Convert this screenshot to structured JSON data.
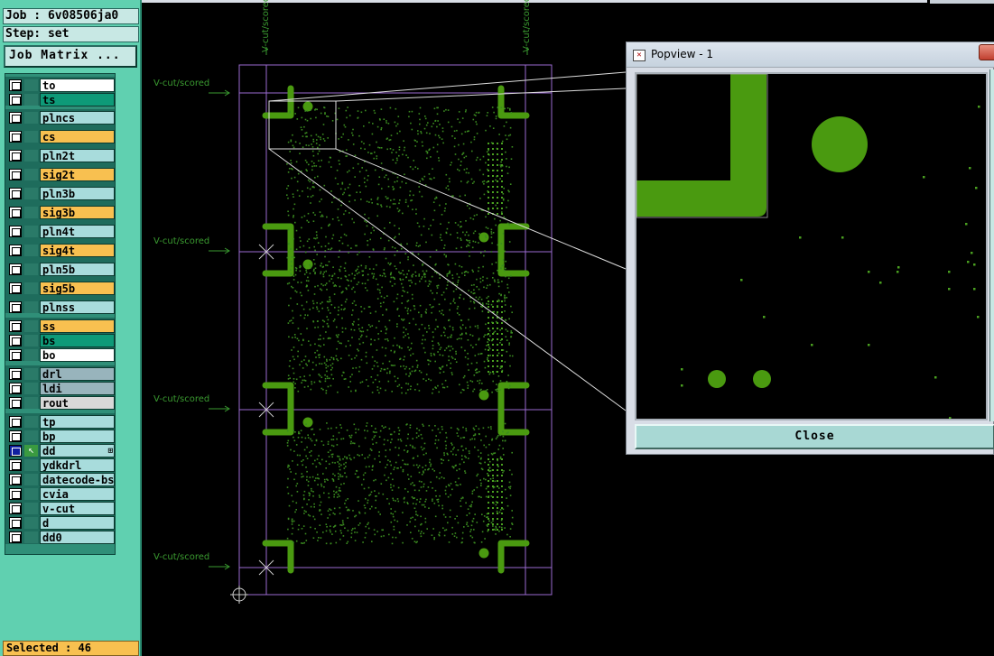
{
  "header": {
    "job": "Job : 6v08506ja0",
    "step": "Step: set",
    "job_matrix_label": "Job Matrix ..."
  },
  "layers": [
    {
      "name": "to",
      "color": "#ffffff",
      "group": 0
    },
    {
      "name": "ts",
      "color": "#0e9a78",
      "group": 0
    },
    {
      "name": "plncs",
      "color": "#a8dcdc",
      "group": 1
    },
    {
      "name": "cs",
      "color": "#f8c050",
      "group": 1
    },
    {
      "name": "pln2t",
      "color": "#a8dcdc",
      "group": 1
    },
    {
      "name": "sig2t",
      "color": "#f8c050",
      "group": 1
    },
    {
      "name": "pln3b",
      "color": "#a8dcdc",
      "group": 1
    },
    {
      "name": "sig3b",
      "color": "#f8c050",
      "group": 1
    },
    {
      "name": "pln4t",
      "color": "#a8dcdc",
      "group": 1
    },
    {
      "name": "sig4t",
      "color": "#f8c050",
      "group": 1
    },
    {
      "name": "pln5b",
      "color": "#a8dcdc",
      "group": 1
    },
    {
      "name": "sig5b",
      "color": "#f8c050",
      "group": 1
    },
    {
      "name": "plnss",
      "color": "#a8dcdc",
      "group": 1
    },
    {
      "name": "ss",
      "color": "#f8c050",
      "group": 2
    },
    {
      "name": "bs",
      "color": "#0e9a78",
      "group": 2
    },
    {
      "name": "bo",
      "color": "#ffffff",
      "group": 2
    },
    {
      "name": "drl",
      "color": "#98b4bc",
      "group": 3
    },
    {
      "name": "ldi",
      "color": "#98b4bc",
      "group": 3
    },
    {
      "name": "rout",
      "color": "#d8d8d8",
      "group": 3
    },
    {
      "name": "tp",
      "color": "#a8dcdc",
      "group": 4
    },
    {
      "name": "bp",
      "color": "#a8dcdc",
      "group": 4
    },
    {
      "name": "dd",
      "color": "#a8dcdc",
      "group": 4,
      "selected": true,
      "icon": "arrow-icon"
    },
    {
      "name": "ydkdrl",
      "color": "#a8dcdc",
      "group": 4
    },
    {
      "name": "datecode-bs",
      "color": "#a8dcdc",
      "group": 4
    },
    {
      "name": "cvia",
      "color": "#a8dcdc",
      "group": 4
    },
    {
      "name": "v-cut",
      "color": "#a8dcdc",
      "group": 4
    },
    {
      "name": "d",
      "color": "#a8dcdc",
      "group": 4
    },
    {
      "name": "dd0",
      "color": "#a8dcdc",
      "group": 4
    }
  ],
  "status": {
    "selected": "Selected : 46"
  },
  "canvas": {
    "vcut_label": "V-cut/scored",
    "vertical_label": "V-cut/scored"
  },
  "popview": {
    "title": "Popview - 1",
    "close_label": "Close"
  },
  "colors": {
    "pcb_green": "#4a9a10",
    "outline_purple": "#9a6ad0",
    "panel_teal": "#60d0b0"
  }
}
